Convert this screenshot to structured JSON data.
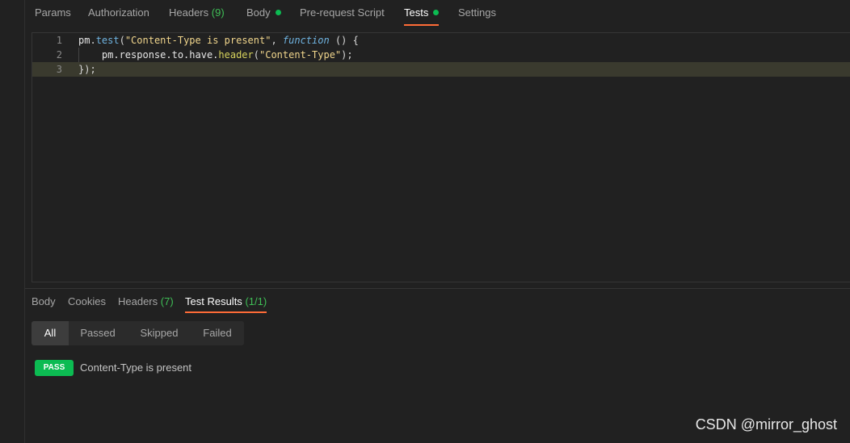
{
  "request_tabs": [
    {
      "label": "Params"
    },
    {
      "label": "Authorization"
    },
    {
      "label": "Headers",
      "count": "(9)"
    },
    {
      "label": "Body"
    },
    {
      "label": "Pre-request Script"
    },
    {
      "label": "Tests"
    },
    {
      "label": "Settings"
    }
  ],
  "active_request_tab": "Tests",
  "editor": {
    "line_numbers": [
      "1",
      "2",
      "3"
    ],
    "line1": {
      "obj": "pm",
      "dot": ".",
      "fn": "test",
      "open": "(",
      "str": "\"Content-Type is present\"",
      "comma": ", ",
      "kw": "function",
      "rest": " () {"
    },
    "line2": {
      "indent": "    ",
      "obj": "pm.response.to.have.",
      "meth": "header",
      "open": "(",
      "str": "\"Content-Type\"",
      "close": ");"
    },
    "line3": "});"
  },
  "response_tabs": [
    {
      "label": "Body"
    },
    {
      "label": "Cookies"
    },
    {
      "label": "Headers",
      "count": "(7)"
    },
    {
      "label": "Test Results",
      "count": "(1/1)"
    }
  ],
  "active_response_tab": "Test Results",
  "filters": [
    "All",
    "Passed",
    "Skipped",
    "Failed"
  ],
  "active_filter": "All",
  "results": [
    {
      "status": "PASS",
      "name": "Content-Type is present"
    }
  ],
  "watermark": "CSDN @mirror_ghost",
  "colors": {
    "accent": "#ff6c37",
    "pass": "#0cbb52",
    "count": "#3fbf56",
    "background": "#212121"
  }
}
